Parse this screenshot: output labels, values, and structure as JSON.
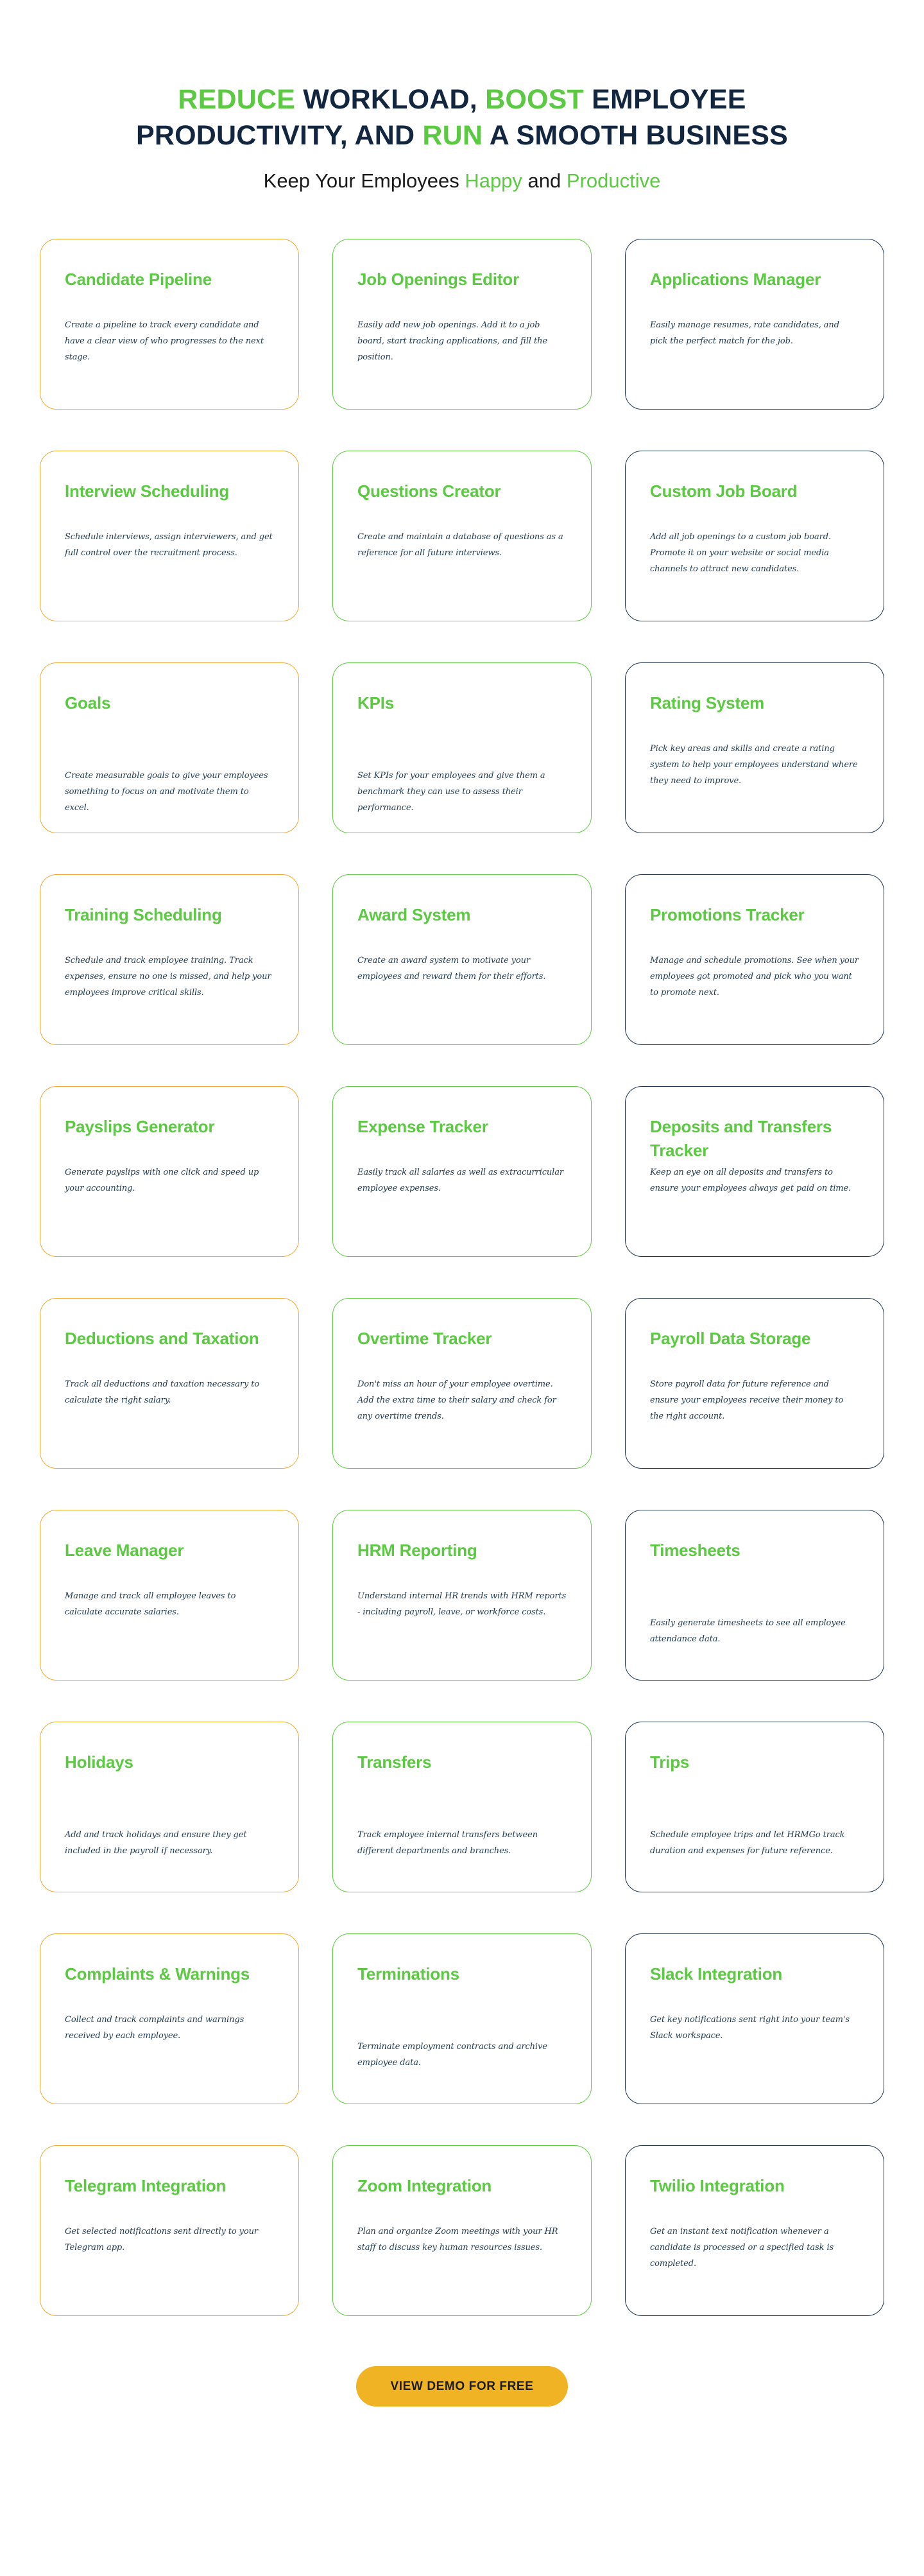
{
  "header": {
    "headline_parts": [
      {
        "text": "REDUCE",
        "highlight": true
      },
      {
        "text": " WORKLOAD, ",
        "highlight": false
      },
      {
        "text": "BOOST",
        "highlight": true
      },
      {
        "text": " EMPLOYEE PRODUCTIVITY, AND ",
        "highlight": false
      },
      {
        "text": "RUN",
        "highlight": true
      },
      {
        "text": " A SMOOTH BUSINESS",
        "highlight": false
      }
    ],
    "headline_plain": "REDUCE WORKLOAD, BOOST EMPLOYEE PRODUCTIVITY, AND RUN A SMOOTH BUSINESS",
    "subhead_parts": [
      {
        "text": "Keep Your Employees ",
        "highlight": false
      },
      {
        "text": "Happy",
        "highlight": true
      },
      {
        "text": " and ",
        "highlight": false
      },
      {
        "text": "Productive",
        "highlight": true
      }
    ],
    "subhead_plain": "Keep Your Employees Happy and Productive"
  },
  "colors": {
    "accent_green": "#5BC941",
    "accent_orange": "#F0A830",
    "accent_navy": "#1B3148",
    "cta_amber": "#F0B323",
    "title_green": "#5BC941",
    "body_navy": "#1E3A52"
  },
  "cards": [
    {
      "title": "Candidate Pipeline",
      "desc": "Create a pipeline to track every candidate and have a clear view of who progresses to the next stage.",
      "border": "orange",
      "one_line": false
    },
    {
      "title": "Job Openings Editor",
      "desc": "Easily add new job openings. Add it to a job board, start tracking applications, and fill the position.",
      "border": "green",
      "one_line": false
    },
    {
      "title": "Applications Manager",
      "desc": "Easily manage resumes, rate candidates, and pick the perfect match for the job.",
      "border": "navy",
      "one_line": false
    },
    {
      "title": "Interview Scheduling",
      "desc": "Schedule interviews, assign interviewers, and get full control over the recruitment process.",
      "border": "orange",
      "one_line": false
    },
    {
      "title": "Questions Creator",
      "desc": "Create and maintain a database of questions as a reference for all future interviews.",
      "border": "green",
      "one_line": false
    },
    {
      "title": "Custom Job Board",
      "desc": "Add all job openings to a custom job board. Promote it on your website or social media channels to attract new candidates.",
      "border": "navy",
      "one_line": false
    },
    {
      "title": "Goals",
      "desc": "Create measurable goals to give your employees something to focus on and motivate them to excel.",
      "border": "orange",
      "one_line": true
    },
    {
      "title": "KPIs",
      "desc": "Set KPIs for your employees and give them a benchmark they can use to assess their performance.",
      "border": "green",
      "one_line": true
    },
    {
      "title": "Rating System",
      "desc": "Pick key areas and skills and create a rating system to help your employees understand where they need to improve.",
      "border": "navy",
      "one_line": false
    },
    {
      "title": "Training Scheduling",
      "desc": "Schedule and track employee training. Track expenses, ensure no one is missed, and help your employees improve critical skills.",
      "border": "orange",
      "one_line": false
    },
    {
      "title": "Award System",
      "desc": "Create an award system to motivate your employees and reward them for their efforts.",
      "border": "green",
      "one_line": false
    },
    {
      "title": "Promotions Tracker",
      "desc": "Manage and schedule promotions. See when your employees got promoted and pick who you want to promote next.",
      "border": "navy",
      "one_line": false
    },
    {
      "title": "Payslips Generator",
      "desc": "Generate payslips with one click and speed up your accounting.",
      "border": "orange",
      "one_line": false
    },
    {
      "title": "Expense Tracker",
      "desc": "Easily track all salaries as well as extracurricular employee expenses.",
      "border": "green",
      "one_line": false
    },
    {
      "title": "Deposits and Transfers Tracker",
      "desc": "Keep an eye on all deposits and transfers to ensure your employees always get paid on time.",
      "border": "navy",
      "one_line": false
    },
    {
      "title": "Deductions and Taxation",
      "desc": "Track all deductions and taxation necessary to calculate the right salary.",
      "border": "orange",
      "one_line": false
    },
    {
      "title": "Overtime Tracker",
      "desc": "Don't miss an hour of your employee overtime. Add the extra time to their salary and check for any overtime trends.",
      "border": "green",
      "one_line": false
    },
    {
      "title": "Payroll Data Storage",
      "desc": "Store payroll data for future reference and ensure your employees receive their money to the right account.",
      "border": "navy",
      "one_line": false
    },
    {
      "title": "Leave Manager",
      "desc": "Manage and track all employee leaves to calculate accurate salaries.",
      "border": "orange",
      "one_line": false
    },
    {
      "title": "HRM Reporting",
      "desc": "Understand internal HR trends with HRM reports - including payroll, leave, or workforce costs.",
      "border": "green",
      "one_line": false
    },
    {
      "title": "Timesheets",
      "desc": "Easily generate timesheets to see all employee attendance data.",
      "border": "navy",
      "one_line": true
    },
    {
      "title": "Holidays",
      "desc": "Add and track holidays and ensure they get included in the payroll if necessary.",
      "border": "orange",
      "one_line": true
    },
    {
      "title": "Transfers",
      "desc": "Track employee internal transfers between different departments and branches.",
      "border": "green",
      "one_line": true
    },
    {
      "title": "Trips",
      "desc": "Schedule employee trips and let HRMGo track duration and expenses for future reference.",
      "border": "navy",
      "one_line": true
    },
    {
      "title": "Complaints & Warnings",
      "desc": "Collect and track complaints and warnings received by each employee.",
      "border": "orange",
      "one_line": false
    },
    {
      "title": "Terminations",
      "desc": "Terminate employment contracts and archive employee data.",
      "border": "green",
      "one_line": true
    },
    {
      "title": "Slack Integration",
      "desc": "Get key notifications sent right into your team's Slack workspace.",
      "border": "navy",
      "one_line": false
    },
    {
      "title": "Telegram Integration",
      "desc": "Get selected notifications sent directly to your Telegram app.",
      "border": "orange",
      "one_line": false
    },
    {
      "title": "Zoom Integration",
      "desc": "Plan and organize Zoom meetings with your HR staff to discuss key human resources issues.",
      "border": "green",
      "one_line": false
    },
    {
      "title": "Twilio Integration",
      "desc": "Get an instant text notification whenever a candidate is processed or a specified task is completed.",
      "border": "navy",
      "one_line": false
    }
  ],
  "cta": {
    "label": "VIEW DEMO FOR FREE"
  }
}
